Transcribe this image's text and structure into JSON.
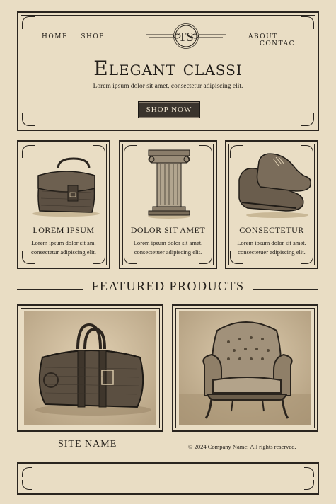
{
  "nav": {
    "left": [
      "HOME",
      "SHOP"
    ],
    "right": [
      "ABOUT",
      "CONTAC"
    ]
  },
  "logo": {
    "monogram": "TS"
  },
  "hero": {
    "title": "Elegant classi",
    "tagline": "Lorem ipsum dolor sit amet, consectetur  adipiscing elit.",
    "button": "SHOP NOW"
  },
  "cards": [
    {
      "title": "LOREM IPSUM",
      "text_line1": "Lorem ipsum dolor sit am.",
      "text_line2": "consectetur adipiscing elit.",
      "icon": "handbag-icon"
    },
    {
      "title": "DOLOR SIT AMET",
      "text_line1": "Lorem ipsum dolor sit amet.",
      "text_line2": "consectetuer adipiscing elit.",
      "icon": "column-icon"
    },
    {
      "title": "CONSECTETUR",
      "text_line1": "Lorem ipsum dolor sit amet.",
      "text_line2": "consectetuer adipiscing elit.",
      "icon": "shoes-icon"
    }
  ],
  "featured": {
    "heading": "FEATURED PRODUCTS",
    "products": [
      {
        "icon": "duffel-bag-icon"
      },
      {
        "icon": "armchair-icon"
      }
    ]
  },
  "footer": {
    "site_name": "SITE NAME",
    "copyright": "© 2024  Company Name: All rights reserved."
  },
  "colors": {
    "background": "#e9ddc4",
    "ink": "#2a251f",
    "button": "#3a342d"
  }
}
